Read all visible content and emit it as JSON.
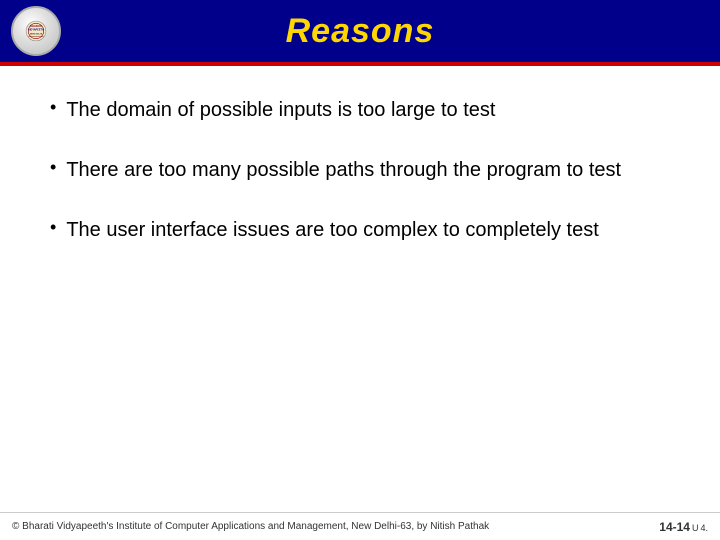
{
  "header": {
    "title": "Reasons",
    "logo_alt": "Bharati Vidyapeeth logo"
  },
  "bullets": [
    {
      "id": 1,
      "text": "The domain of possible inputs is too large to test"
    },
    {
      "id": 2,
      "text": "There are too many possible paths through the program to test"
    },
    {
      "id": 3,
      "text": "The user interface issues are too complex to completely test"
    }
  ],
  "footer": {
    "copyright": "© Bharati Vidyapeeth's Institute of Computer Applications and Management, New Delhi-63, by  Nitish Pathak",
    "page_main": "14-14",
    "page_superscript": "U",
    "page_subscript": "4."
  },
  "colors": {
    "header_bg": "#00008B",
    "title_color": "#FFD700",
    "red_line": "#CC0000"
  }
}
